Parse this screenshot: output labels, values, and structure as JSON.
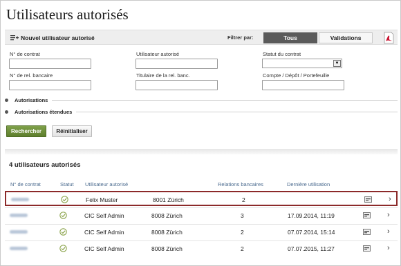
{
  "page": {
    "title": "Utilisateurs autorisés"
  },
  "toolbar": {
    "add_label": "Nouvel utilisateur autorisé",
    "filter_label": "Filtrer par:",
    "filter_all": "Tous",
    "filter_validations": "Validations",
    "pdf_icon": "pdf-icon"
  },
  "form": {
    "contract_no_label": "N° de contrat",
    "contract_no_value": "",
    "authorized_user_label": "Utilisateur autorisé",
    "authorized_user_value": "",
    "contract_status_label": "Statut du contrat",
    "contract_status_value": "",
    "bank_rel_label": "N° de rel. bancaire",
    "bank_rel_value": "",
    "holder_label": "Titulaire de la rel. banc.",
    "holder_value": "",
    "account_label": "Compte / Dépôt / Portefeuille",
    "account_value": ""
  },
  "sections": {
    "authorizations": "Autorisations",
    "extended_authorizations": "Autorisations étendues"
  },
  "buttons": {
    "search": "Rechercher",
    "reset": "Réinitialiser"
  },
  "results": {
    "title": "4 utilisateurs autorisés",
    "columns": {
      "contract": "N° de contrat",
      "status": "Statut",
      "user": "Utilisateur autorisé",
      "relations": "Relations bancaires",
      "last_use": "Dernière utilisation"
    },
    "rows": [
      {
        "user": "Felix Muster",
        "location": "8001 Zürich",
        "relations": "2",
        "last_use": ""
      },
      {
        "user": "CIC Self Admin",
        "location": "8008 Zürich",
        "relations": "3",
        "last_use": "17.09.2014, 11:19"
      },
      {
        "user": "CIC Self Admin",
        "location": "8008 Zürich",
        "relations": "2",
        "last_use": "07.07.2014, 15:14"
      },
      {
        "user": "CIC Self Admin",
        "location": "8008 Zürich",
        "relations": "2",
        "last_use": "07.07.2015, 11:27"
      }
    ]
  },
  "colors": {
    "accent_green": "#6b8f38",
    "header_link": "#4a6a8e",
    "highlight_border": "#8c2a2a",
    "segment_active": "#5a5a5a"
  }
}
